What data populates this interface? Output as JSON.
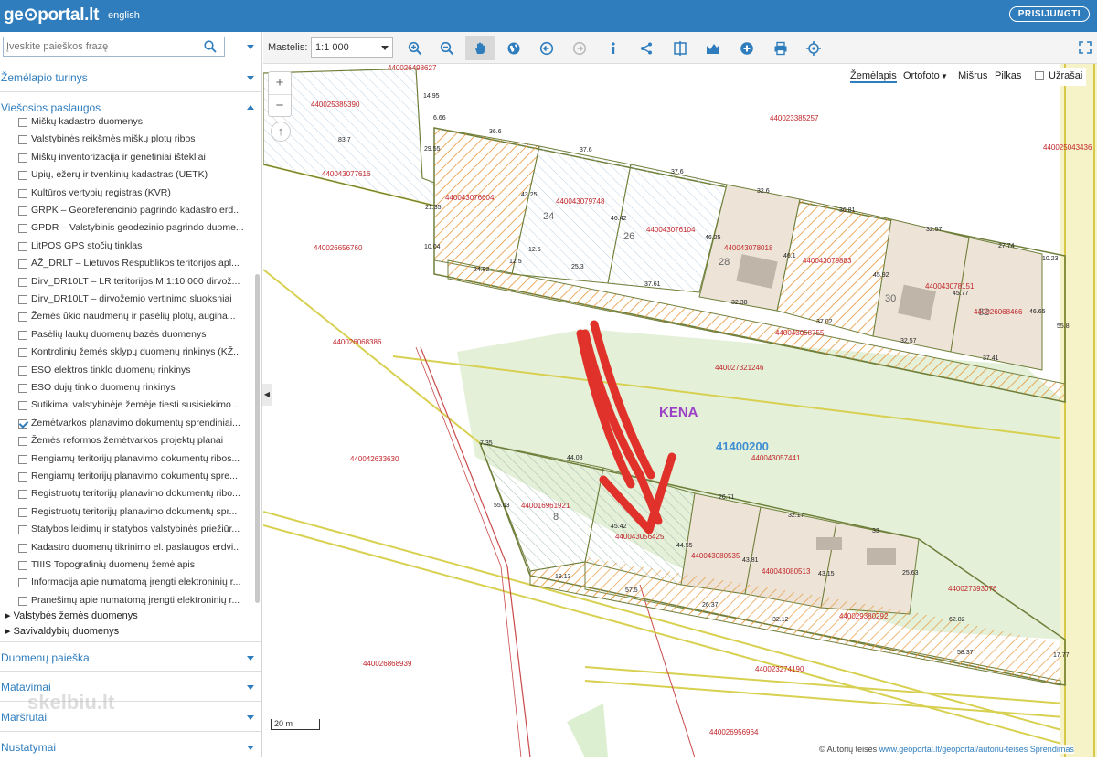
{
  "app": {
    "logo": "ge⊙portal.lt",
    "lang": "english",
    "login": "PRISIJUNGTI"
  },
  "search": {
    "placeholder": "Įveskite paieškos frazę"
  },
  "sections": {
    "turinys": "Žemėlapio turinys",
    "viesosios": "Viešosios paslaugos",
    "paieska": "Duomenų paieška",
    "matavimai": "Matavimai",
    "marsrutai": "Maršrutai",
    "nustatymai": "Nustatymai"
  },
  "layers": [
    {
      "label": "Miškų kadastro duomenys",
      "checked": false
    },
    {
      "label": "Valstybinės reikšmės miškų plotų ribos",
      "checked": false
    },
    {
      "label": "Miškų inventorizacija ir genetiniai ištekliai",
      "checked": false
    },
    {
      "label": "Upių, ežerų ir tvenkinių kadastras (UETK)",
      "checked": false
    },
    {
      "label": "Kultūros vertybių registras (KVR)",
      "checked": false
    },
    {
      "label": "GRPK – Georeferencinio pagrindo kadastro erd...",
      "checked": false
    },
    {
      "label": "GPDR – Valstybinis geodezinio pagrindo duome...",
      "checked": false
    },
    {
      "label": "LitPOS GPS stočių tinklas",
      "checked": false
    },
    {
      "label": "AŽ_DRLT – Lietuvos Respublikos teritorijos apl...",
      "checked": false
    },
    {
      "label": "Dirv_DR10LT – LR teritorijos M 1:10 000 dirvož...",
      "checked": false
    },
    {
      "label": "Dirv_DR10LT – dirvožemio vertinimo sluoksniai",
      "checked": false
    },
    {
      "label": "Žemės ūkio naudmenų ir pasėlių plotų, augina...",
      "checked": false
    },
    {
      "label": "Pasėlių laukų duomenų bazės duomenys",
      "checked": false
    },
    {
      "label": "Kontrolinių žemės sklypų duomenų rinkinys (KŽ...",
      "checked": false
    },
    {
      "label": "ESO elektros tinklo duomenų rinkinys",
      "checked": false
    },
    {
      "label": "ESO dujų tinklo duomenų rinkinys",
      "checked": false
    },
    {
      "label": "Sutikimai valstybinėje žemėje tiesti susisiekimo ...",
      "checked": false
    },
    {
      "label": "Žemėtvarkos planavimo dokumentų sprendiniai...",
      "checked": true
    },
    {
      "label": "Žemės reformos žemėtvarkos projektų planai",
      "checked": false
    },
    {
      "label": "Rengiamų teritorijų planavimo dokumentų ribos...",
      "checked": false
    },
    {
      "label": "Rengiamų teritorijų planavimo dokumentų spre...",
      "checked": false
    },
    {
      "label": "Registruotų teritorijų planavimo dokumentų ribo...",
      "checked": false
    },
    {
      "label": "Registruotų teritorijų planavimo dokumentų spr...",
      "checked": false
    },
    {
      "label": "Statybos leidimų ir statybos valstybinės priežiūr...",
      "checked": false
    },
    {
      "label": "Kadastro duomenų tikrinimo el. paslaugos erdvi...",
      "checked": false
    },
    {
      "label": "TIIIS Topografinių duomenų žemėlapis",
      "checked": false
    },
    {
      "label": "Informacija apie numatomą įrengti elektroninių r...",
      "checked": false
    },
    {
      "label": "Pranešimų apie numatomą įrengti elektroninių r...",
      "checked": false
    }
  ],
  "tree": [
    "Valstybės žemės duomenys",
    "Savivaldybių duomenys"
  ],
  "toolbar": {
    "scale_label": "Mastelis:",
    "scale_value": "1:1 000"
  },
  "baselayers": {
    "a": "Žemėlapis",
    "b": "Ortofoto",
    "c": "Mišrus",
    "d": "Pilkas",
    "e": "Užrašai"
  },
  "map": {
    "scalebar": "20 m",
    "attribution_prefix": "© Autorių teisės",
    "attribution_link": "www.geoportal.lt/geoportal/autoriu-teises",
    "attribution_end": "Sprendimas",
    "watermark": "skelbiu.lt",
    "kena": "KENA",
    "code": "41400200",
    "parcels": [
      "440026498627",
      "440025385390",
      "440023385257",
      "440025043436",
      "440043077616",
      "440043076604",
      "440043079748",
      "440043076104",
      "440043078018",
      "440043079883",
      "440043078151",
      "440026068466",
      "440026656760",
      "440026068386",
      "440027321246",
      "440042633630",
      "440043057441",
      "440016961921",
      "440043056425",
      "440043080535",
      "440043080513",
      "440029380292",
      "440027393076",
      "440026868939",
      "440023274190",
      "440026956964",
      "440043058755"
    ],
    "numbers": [
      "24",
      "26",
      "28",
      "30",
      "32",
      "8",
      "14.95",
      "6.66",
      "83.7",
      "36.6",
      "37.6",
      "37.6",
      "32.6",
      "36.81",
      "32.57",
      "27.74",
      "10.23",
      "29.55",
      "21.35",
      "43.25",
      "46.42",
      "46.25",
      "46.1",
      "45.92",
      "45.77",
      "10.04",
      "24.82",
      "25.3",
      "37.61",
      "32.38",
      "37.02",
      "32.57",
      "37.41",
      "46.65",
      "55.8",
      "12.5",
      "12.5",
      "7.35",
      "44.08",
      "55.03",
      "45.42",
      "44.55",
      "26.71",
      "32.17",
      "33",
      "43.81",
      "43.15",
      "25.63",
      "62.82",
      "18.13",
      "57.5",
      "26.37",
      "32.12",
      "58.37",
      "17.77"
    ]
  }
}
